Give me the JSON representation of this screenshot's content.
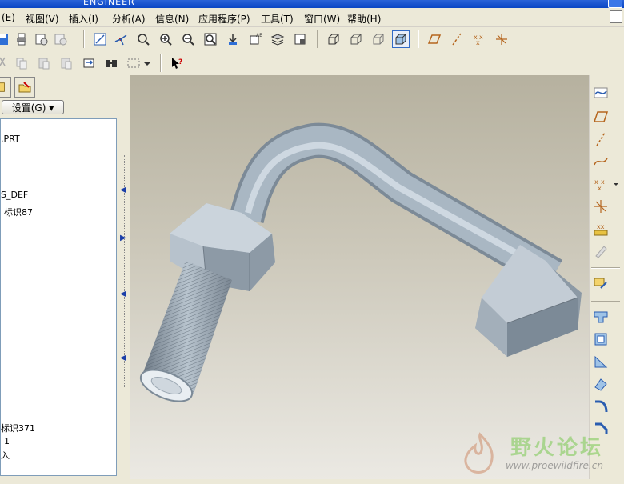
{
  "window": {
    "title": "ENGINEER"
  },
  "menu": [
    {
      "id": "edit",
      "label": "(E)"
    },
    {
      "id": "view",
      "label": "视图(V)"
    },
    {
      "id": "insert",
      "label": "插入(I)"
    },
    {
      "id": "analysis",
      "label": "分析(A)"
    },
    {
      "id": "info",
      "label": "信息(N)"
    },
    {
      "id": "applications",
      "label": "应用程序(P)"
    },
    {
      "id": "tools",
      "label": "工具(T)"
    },
    {
      "id": "window",
      "label": "窗口(W)"
    },
    {
      "id": "help",
      "label": "帮助(H)"
    }
  ],
  "model_tree": {
    "settings_label": "设置(G) ▾",
    "rows": [
      {
        "text": ".PRT"
      },
      {
        "text": "S_DEF"
      },
      {
        "text": "标识87"
      },
      {
        "text": "标识371"
      },
      {
        "text": "1"
      },
      {
        "text": "入"
      }
    ]
  },
  "watermark": {
    "name": "野火论坛",
    "url": "www.proewildfire.cn"
  },
  "colors": {
    "model_fill": "#a9b7c3",
    "model_shadow": "#7c8a97",
    "model_highlight": "#d7e0e8",
    "viewport_top": "#b6b19f",
    "viewport_bottom": "#ebe9e3"
  }
}
